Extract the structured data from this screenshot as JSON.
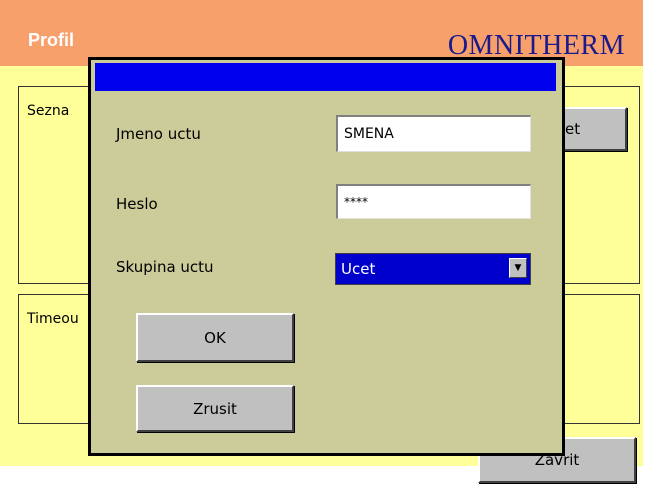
{
  "header": {
    "title": "Profil",
    "brand": "OMNITHERM"
  },
  "groups": {
    "list_label": "Sezna",
    "timeout_label": "Timeou"
  },
  "background_buttons": {
    "right_partial": "et",
    "close": "Zavrit"
  },
  "dialog": {
    "account_label": "Jmeno uctu",
    "account_value": "SMENA",
    "password_label": "Heslo",
    "password_value": "****",
    "group_label": "Skupina uctu",
    "group_selected": "Ucet",
    "ok": "OK",
    "cancel": "Zrusit"
  },
  "colors": {
    "header_bg": "#f7a06b",
    "app_bg": "#ffff99",
    "dialog_bg": "#cccc9a",
    "titlebar": "#0000ee",
    "select_bg": "#0000cc"
  }
}
